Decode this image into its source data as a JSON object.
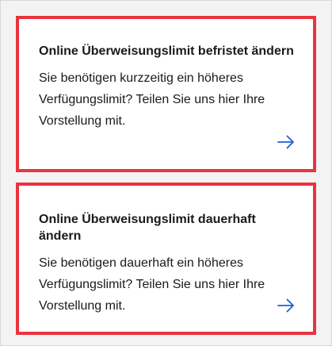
{
  "colors": {
    "card_border": "#e8343f",
    "arrow": "#1f5fd6",
    "text": "#1a1a1a",
    "background": "#f3f3f3"
  },
  "cards": [
    {
      "title": "Online Überweisungslimit befristet ändern",
      "description": "Sie benötigen kurzzeitig ein höheres Verfügungslimit? Teilen Sie uns hier Ihre Vorstellung mit.",
      "icon": "arrow-right-icon"
    },
    {
      "title": "Online Überweisungslimit dauerhaft ändern",
      "description": "Sie benötigen dauerhaft ein höheres Verfügungslimit? Teilen Sie uns hier Ihre Vorstellung mit.",
      "icon": "arrow-right-icon"
    }
  ]
}
